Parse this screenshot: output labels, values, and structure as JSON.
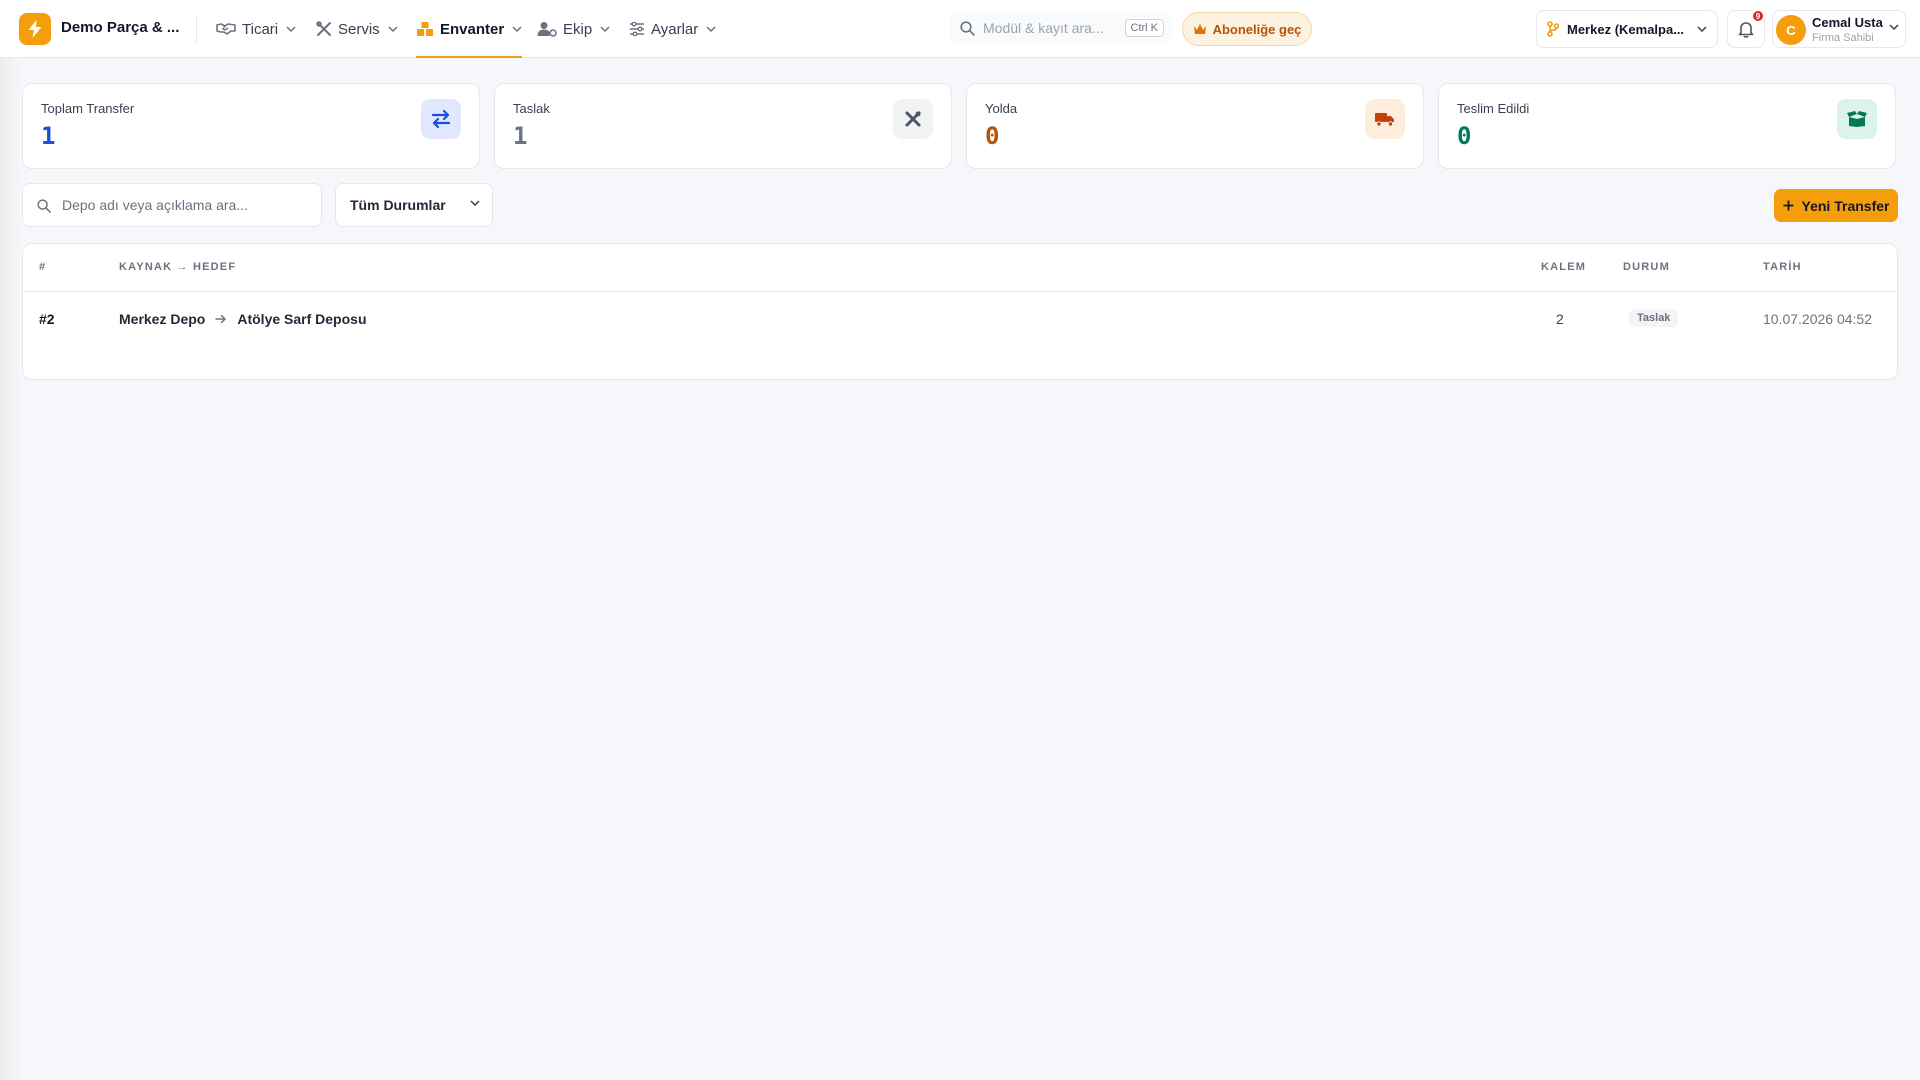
{
  "colors": {
    "accent": "#f59e0b",
    "total_value": "#1d4ed8",
    "draft_value": "#6b7280",
    "transit_value": "#b45309",
    "delivered_value": "#047857"
  },
  "header": {
    "company": "Demo Parça & ...",
    "nav": [
      {
        "label": "Ticari",
        "icon": "handshake-icon"
      },
      {
        "label": "Servis",
        "icon": "tools-icon"
      },
      {
        "label": "Envanter",
        "icon": "boxes-icon",
        "active": true
      },
      {
        "label": "Ekip",
        "icon": "users-gear-icon"
      },
      {
        "label": "Ayarlar",
        "icon": "sliders-icon"
      }
    ],
    "search_placeholder": "Modül & kayıt ara...",
    "search_shortcut": "Ctrl K",
    "subscribe_label": "Aboneliğe geç",
    "branch_label": "Merkez (Kemalpa...",
    "notification_count": "9",
    "user": {
      "initial": "C",
      "name": "Cemal Usta",
      "role": "Firma Sahibi"
    }
  },
  "stats": [
    {
      "label": "Toplam Transfer",
      "value": "1",
      "icon": "transfer-arrows-icon"
    },
    {
      "label": "Taslak",
      "value": "1",
      "icon": "draft-tools-icon"
    },
    {
      "label": "Yolda",
      "value": "0",
      "icon": "truck-icon"
    },
    {
      "label": "Teslim Edildi",
      "value": "0",
      "icon": "open-box-icon"
    }
  ],
  "filters": {
    "search_placeholder": "Depo adı veya açıklama ara...",
    "status_selected": "Tüm Durumlar",
    "new_button": "Yeni Transfer"
  },
  "table": {
    "columns": {
      "id": "#",
      "route": "KAYNAK → HEDEF",
      "qty": "KALEM",
      "status": "DURUM",
      "date": "TARİH"
    },
    "rows": [
      {
        "id": "#2",
        "source": "Merkez Depo",
        "target": "Atölye Sarf Deposu",
        "qty": "2",
        "status": "Taslak",
        "date": "10.07.2026 04:52"
      }
    ]
  }
}
